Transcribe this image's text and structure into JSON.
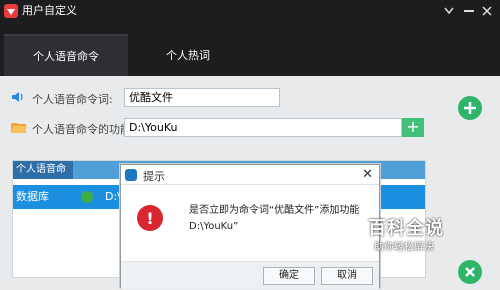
{
  "window": {
    "title": "用户自定义",
    "tabs": [
      {
        "label": "个人语音命令",
        "active": true
      },
      {
        "label": "个人热词",
        "active": false
      }
    ]
  },
  "form": {
    "command_label": "个人语音命令词:",
    "command_value": "优酷文件",
    "function_label": "个人语音命令的功能:",
    "function_value": "D:\\YouKu"
  },
  "table": {
    "header": "个人语音命令",
    "rows": [
      {
        "name": "数据库",
        "path": "D:\\"
      }
    ]
  },
  "dialog": {
    "title": "提示",
    "message_line1": "是否立即为命令词“优酷文件”添加功能",
    "message_line2": "D:\\YouKu”",
    "ok": "确定",
    "cancel": "取消"
  },
  "watermark": {
    "text": "百科全说",
    "sub": "助你轻松解决"
  },
  "colors": {
    "title_bar": "#1d1d1f",
    "accent_green": "#2fb56a",
    "selection_blue": "#1d8fe0",
    "error_red": "#d7262f"
  }
}
